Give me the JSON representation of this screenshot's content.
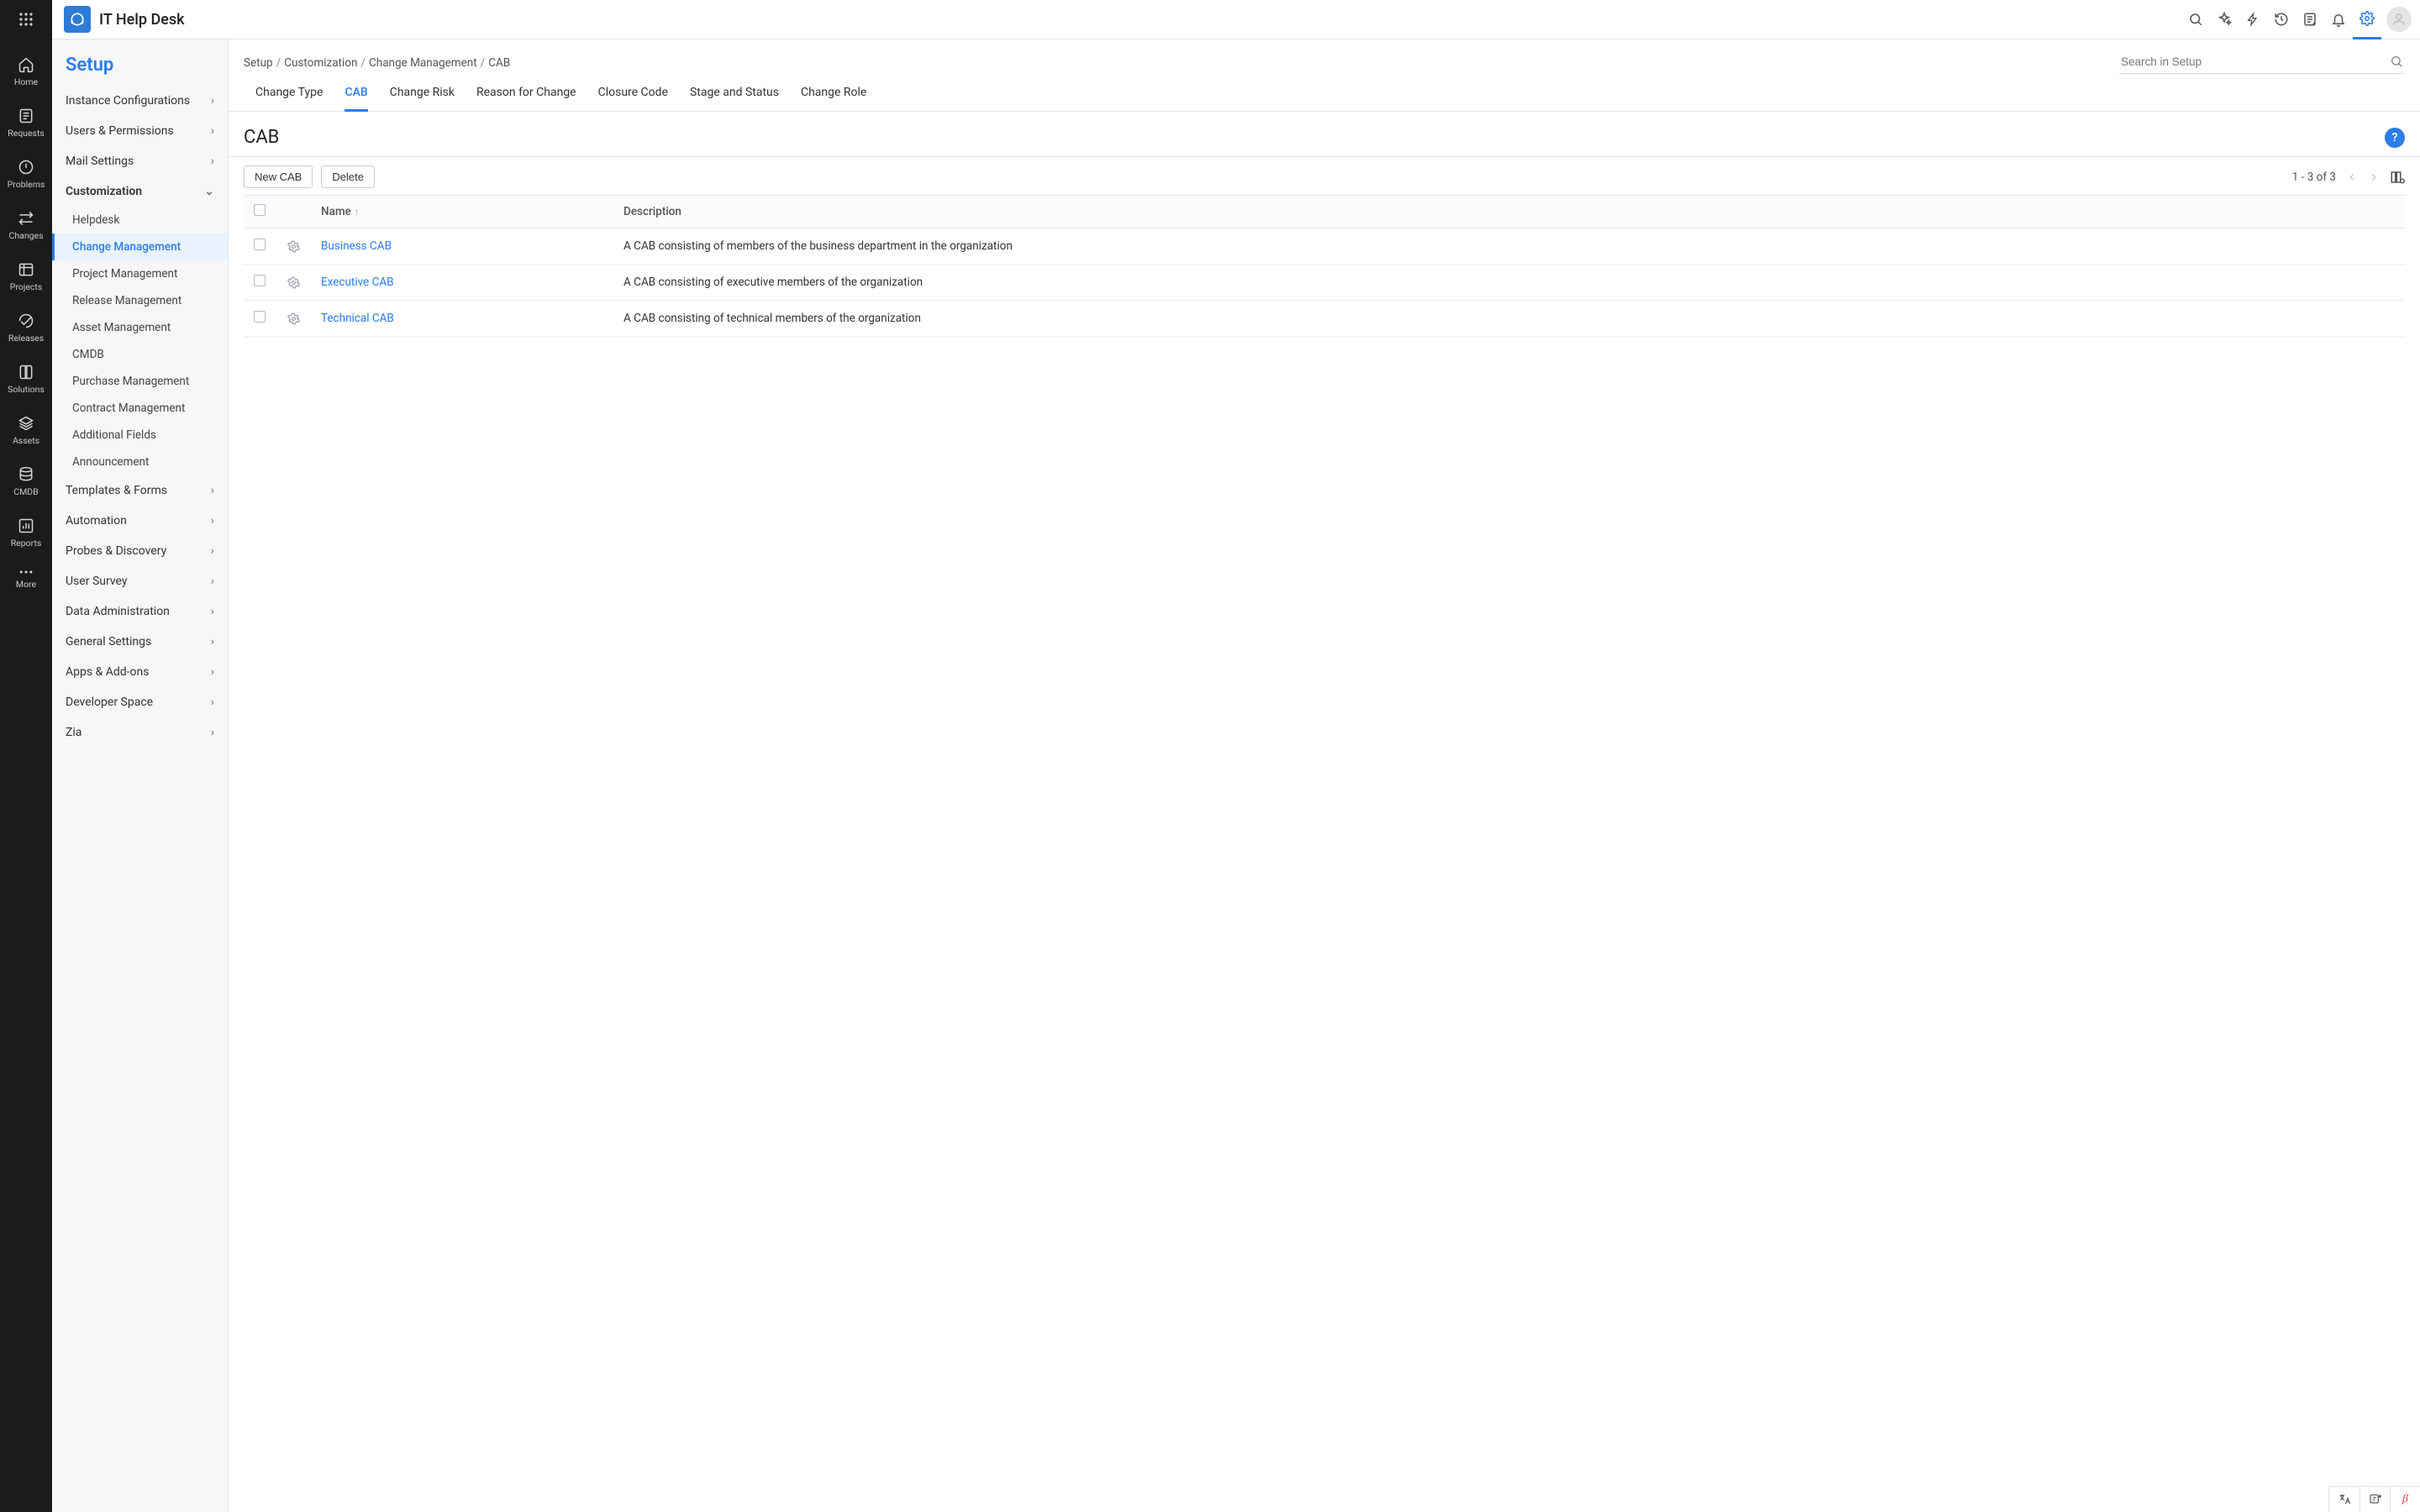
{
  "brand_title": "IT Help Desk",
  "rail": [
    {
      "label": "Home"
    },
    {
      "label": "Requests"
    },
    {
      "label": "Problems"
    },
    {
      "label": "Changes"
    },
    {
      "label": "Projects"
    },
    {
      "label": "Releases"
    },
    {
      "label": "Solutions"
    },
    {
      "label": "Assets"
    },
    {
      "label": "CMDB"
    },
    {
      "label": "Reports"
    },
    {
      "label": "More"
    }
  ],
  "setup_sidebar": {
    "title": "Setup",
    "groups": [
      {
        "label": "Instance Configurations",
        "expandable": true
      },
      {
        "label": "Users & Permissions",
        "expandable": true
      },
      {
        "label": "Mail Settings",
        "expandable": true
      },
      {
        "label": "Customization",
        "expandable": true,
        "expanded": true,
        "bold": true,
        "children": [
          {
            "label": "Helpdesk"
          },
          {
            "label": "Change Management",
            "active": true
          },
          {
            "label": "Project Management"
          },
          {
            "label": "Release Management"
          },
          {
            "label": "Asset Management"
          },
          {
            "label": "CMDB"
          },
          {
            "label": "Purchase Management"
          },
          {
            "label": "Contract Management"
          },
          {
            "label": "Additional Fields"
          },
          {
            "label": "Announcement"
          }
        ]
      },
      {
        "label": "Templates & Forms",
        "expandable": true
      },
      {
        "label": "Automation",
        "expandable": true
      },
      {
        "label": "Probes & Discovery",
        "expandable": true
      },
      {
        "label": "User Survey",
        "expandable": true
      },
      {
        "label": "Data Administration",
        "expandable": true
      },
      {
        "label": "General Settings",
        "expandable": true
      },
      {
        "label": "Apps & Add-ons",
        "expandable": true
      },
      {
        "label": "Developer Space",
        "expandable": true
      },
      {
        "label": "Zia",
        "expandable": true
      }
    ]
  },
  "breadcrumbs": [
    "Setup",
    "Customization",
    "Change Management",
    "CAB"
  ],
  "search_placeholder": "Search in Setup",
  "tabs": [
    {
      "label": "Change Type"
    },
    {
      "label": "CAB",
      "active": true
    },
    {
      "label": "Change Risk"
    },
    {
      "label": "Reason for Change"
    },
    {
      "label": "Closure Code"
    },
    {
      "label": "Stage and Status"
    },
    {
      "label": "Change Role"
    }
  ],
  "section_title": "CAB",
  "help_label": "?",
  "buttons": {
    "new": "New CAB",
    "delete": "Delete"
  },
  "pager_text": "1 - 3 of 3",
  "table": {
    "columns": {
      "name": "Name",
      "description": "Description"
    },
    "rows": [
      {
        "name": "Business CAB",
        "description": "A CAB consisting of members of the business department in the organization"
      },
      {
        "name": "Executive CAB",
        "description": "A CAB consisting of executive members of the organization"
      },
      {
        "name": "Technical CAB",
        "description": "A CAB consisting of technical members of the organization"
      }
    ]
  },
  "footer_beta": "β"
}
